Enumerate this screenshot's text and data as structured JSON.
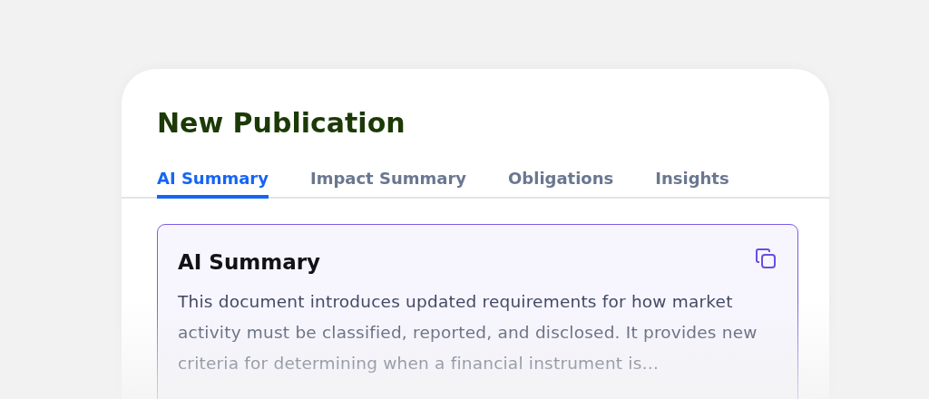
{
  "title": "New Publication",
  "tabs": [
    {
      "label": "AI Summary",
      "selected": true
    },
    {
      "label": "Impact Summary",
      "selected": false
    },
    {
      "label": "Obligations",
      "selected": false
    },
    {
      "label": "Insights",
      "selected": false
    }
  ],
  "summary": {
    "heading": "AI Summary",
    "text": "This document introduces updated requirements for how market activity must be classified, reported, and disclosed. It provides new criteria for determining when a financial instrument is…"
  }
}
